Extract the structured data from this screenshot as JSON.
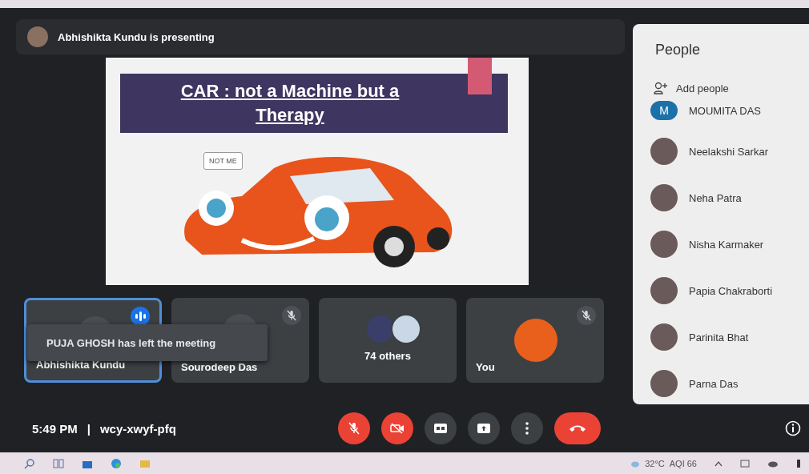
{
  "banner": {
    "text": "Abhishikta Kundu is presenting"
  },
  "slide": {
    "title": "CAR : not a Machine but a Therapy",
    "bubble": "NOT ME"
  },
  "tiles": [
    {
      "kind": "person",
      "name": "Abhishikta Kundu",
      "speaking": true
    },
    {
      "kind": "person",
      "name": "Sourodeep Das",
      "speaking": false,
      "muted": true
    },
    {
      "kind": "group",
      "name": "74 others"
    },
    {
      "kind": "self",
      "name": "You",
      "speaking": false,
      "muted": true
    }
  ],
  "toast": "PUJA GHOSH has left the meeting",
  "meeting": {
    "time": "5:49 PM",
    "separator": "|",
    "code": "wcy-xwyf-pfq"
  },
  "controls": [
    {
      "kind": "mic",
      "on": false
    },
    {
      "kind": "camera",
      "on": false
    },
    {
      "kind": "captions"
    },
    {
      "kind": "present"
    },
    {
      "kind": "more"
    },
    {
      "kind": "hangup"
    }
  ],
  "people": {
    "title": "People",
    "add_label": "Add people",
    "members": [
      {
        "name": "MOUMITA DAS",
        "initial": "M"
      },
      {
        "name": "Neelakshi Sarkar"
      },
      {
        "name": "Neha Patra"
      },
      {
        "name": "Nisha Karmaker"
      },
      {
        "name": "Papia Chakraborti"
      },
      {
        "name": "Parinita Bhat"
      },
      {
        "name": "Parna Das"
      }
    ]
  },
  "taskbar": {
    "weather": "32°C",
    "aqi": "AQI 66"
  }
}
